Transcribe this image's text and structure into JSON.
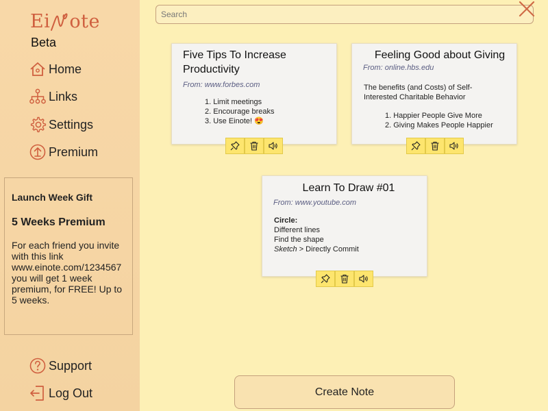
{
  "app": {
    "logo_left": "Ei",
    "logo_right": "ote",
    "beta_label": "Beta"
  },
  "sidebar": {
    "nav": [
      {
        "label": "Home",
        "icon": "home-icon"
      },
      {
        "label": "Links",
        "icon": "sitemap-icon"
      },
      {
        "label": "Settings",
        "icon": "gear-icon"
      },
      {
        "label": "Premium",
        "icon": "upload-circle-icon"
      }
    ],
    "bottom": [
      {
        "label": "Support",
        "icon": "question-circle-icon"
      },
      {
        "label": "Log Out",
        "icon": "logout-icon"
      }
    ],
    "gift": {
      "title": "Launch Week Gift",
      "subtitle": "5 Weeks Premium",
      "body": "For each friend you invite with this link www.einote.com/1234567 you will get 1 week premium, for FREE! Up to 5 weeks."
    }
  },
  "search": {
    "placeholder": "Search",
    "value": ""
  },
  "notes": [
    {
      "title": "Five Tips To Increase Productivity",
      "source": "From: www.forbes.com",
      "items": [
        "1. Limit meetings",
        "2. Encourage breaks",
        "3. Use Einote! 😍"
      ]
    },
    {
      "title": "Feeling Good about Giving",
      "source": "From: online.hbs.edu",
      "intro": "The benefits (and Costs) of Self-Interested Charitable Behavior",
      "items": [
        "1. Happier People Give More",
        "2. Giving Makes People Happier"
      ]
    },
    {
      "title": "Learn To Draw #01",
      "source": "From: www.youtube.com",
      "heading": "Circle:",
      "line1": "Different lines",
      "line2": "Find the shape",
      "line3_em": "Sketch",
      "line3_rest": " > Directly Commit"
    }
  ],
  "create_button": {
    "label": "Create Note"
  },
  "colors": {
    "background": "#fdf0b5",
    "sidebar": "#f7d6a6",
    "brand": "#cf5f3f",
    "action_button": "#fde56e",
    "source_text": "#5a5d82"
  }
}
